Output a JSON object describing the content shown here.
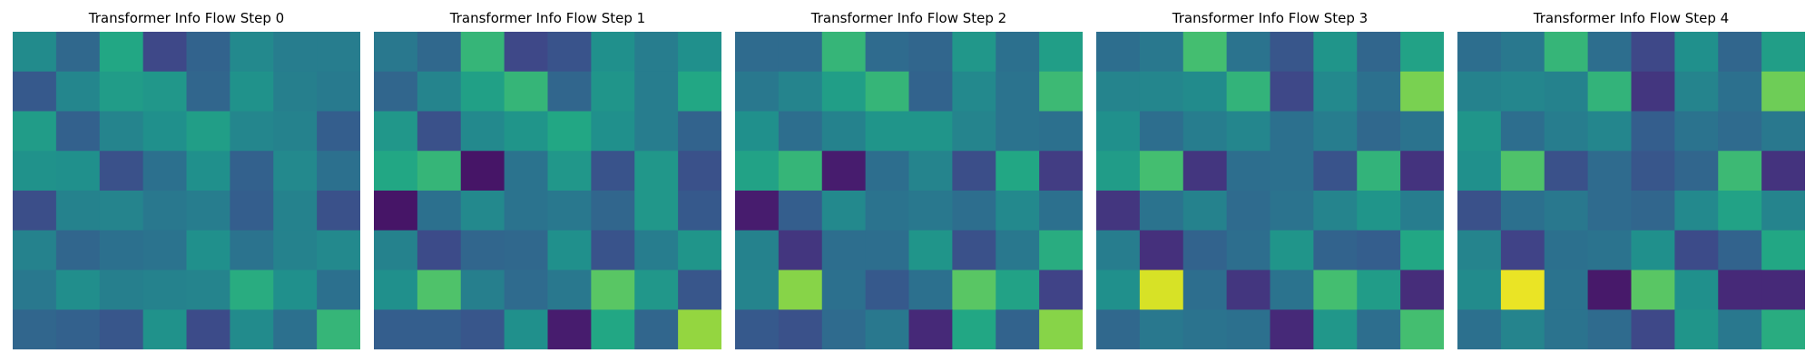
{
  "chart_data": [
    {
      "type": "heatmap",
      "title": "Transformer Info Flow Step 0",
      "rows": 8,
      "cols": 8,
      "colormap": "viridis",
      "vlim": [
        0,
        1
      ],
      "values": [
        [
          0.48,
          0.34,
          0.6,
          0.22,
          0.32,
          0.47,
          0.42,
          0.42
        ],
        [
          0.28,
          0.46,
          0.55,
          0.53,
          0.33,
          0.51,
          0.43,
          0.41
        ],
        [
          0.55,
          0.31,
          0.45,
          0.5,
          0.56,
          0.46,
          0.44,
          0.3
        ],
        [
          0.51,
          0.5,
          0.25,
          0.37,
          0.5,
          0.31,
          0.47,
          0.37
        ],
        [
          0.24,
          0.44,
          0.45,
          0.4,
          0.42,
          0.3,
          0.44,
          0.25
        ],
        [
          0.44,
          0.33,
          0.37,
          0.38,
          0.5,
          0.38,
          0.44,
          0.47
        ],
        [
          0.4,
          0.49,
          0.43,
          0.44,
          0.45,
          0.62,
          0.5,
          0.37
        ],
        [
          0.33,
          0.31,
          0.27,
          0.51,
          0.23,
          0.48,
          0.37,
          0.66
        ]
      ]
    },
    {
      "type": "heatmap",
      "title": "Transformer Info Flow Step 1",
      "rows": 8,
      "cols": 8,
      "colormap": "viridis",
      "vlim": [
        0,
        1
      ],
      "values": [
        [
          0.4,
          0.34,
          0.66,
          0.22,
          0.26,
          0.5,
          0.42,
          0.5
        ],
        [
          0.33,
          0.45,
          0.57,
          0.66,
          0.33,
          0.52,
          0.42,
          0.6
        ],
        [
          0.53,
          0.25,
          0.47,
          0.52,
          0.6,
          0.5,
          0.42,
          0.32
        ],
        [
          0.6,
          0.66,
          0.06,
          0.38,
          0.53,
          0.26,
          0.53,
          0.25
        ],
        [
          0.06,
          0.37,
          0.47,
          0.38,
          0.4,
          0.33,
          0.53,
          0.28
        ],
        [
          0.44,
          0.23,
          0.33,
          0.34,
          0.5,
          0.26,
          0.42,
          0.52
        ],
        [
          0.5,
          0.72,
          0.43,
          0.35,
          0.4,
          0.74,
          0.53,
          0.27
        ],
        [
          0.3,
          0.3,
          0.27,
          0.5,
          0.08,
          0.6,
          0.33,
          0.84
        ]
      ]
    },
    {
      "type": "heatmap",
      "title": "Transformer Info Flow Step 2",
      "rows": 8,
      "cols": 8,
      "colormap": "viridis",
      "vlim": [
        0,
        1
      ],
      "values": [
        [
          0.35,
          0.35,
          0.66,
          0.35,
          0.33,
          0.53,
          0.37,
          0.56
        ],
        [
          0.4,
          0.45,
          0.56,
          0.66,
          0.32,
          0.47,
          0.38,
          0.68
        ],
        [
          0.5,
          0.36,
          0.44,
          0.52,
          0.52,
          0.45,
          0.38,
          0.37
        ],
        [
          0.58,
          0.66,
          0.08,
          0.36,
          0.45,
          0.24,
          0.6,
          0.18
        ],
        [
          0.08,
          0.3,
          0.47,
          0.38,
          0.4,
          0.36,
          0.47,
          0.37
        ],
        [
          0.44,
          0.16,
          0.36,
          0.36,
          0.52,
          0.25,
          0.4,
          0.62
        ],
        [
          0.45,
          0.82,
          0.37,
          0.28,
          0.37,
          0.74,
          0.58,
          0.2
        ],
        [
          0.28,
          0.25,
          0.35,
          0.4,
          0.12,
          0.6,
          0.32,
          0.82
        ]
      ]
    },
    {
      "type": "heatmap",
      "title": "Transformer Info Flow Step 3",
      "rows": 8,
      "cols": 8,
      "colormap": "viridis",
      "vlim": [
        0,
        1
      ],
      "values": [
        [
          0.36,
          0.4,
          0.7,
          0.38,
          0.27,
          0.52,
          0.33,
          0.58
        ],
        [
          0.45,
          0.46,
          0.48,
          0.65,
          0.22,
          0.47,
          0.37,
          0.8
        ],
        [
          0.5,
          0.36,
          0.42,
          0.46,
          0.37,
          0.42,
          0.34,
          0.38
        ],
        [
          0.55,
          0.7,
          0.16,
          0.36,
          0.37,
          0.26,
          0.65,
          0.15
        ],
        [
          0.16,
          0.38,
          0.44,
          0.35,
          0.38,
          0.45,
          0.52,
          0.42
        ],
        [
          0.42,
          0.14,
          0.32,
          0.36,
          0.52,
          0.32,
          0.3,
          0.6
        ],
        [
          0.5,
          0.94,
          0.36,
          0.16,
          0.38,
          0.7,
          0.55,
          0.13
        ],
        [
          0.34,
          0.4,
          0.38,
          0.37,
          0.12,
          0.53,
          0.36,
          0.7
        ]
      ]
    },
    {
      "type": "heatmap",
      "title": "Transformer Info Flow Step 4",
      "rows": 8,
      "cols": 8,
      "colormap": "viridis",
      "vlim": [
        0,
        1
      ],
      "values": [
        [
          0.36,
          0.4,
          0.66,
          0.36,
          0.22,
          0.5,
          0.33,
          0.56
        ],
        [
          0.44,
          0.46,
          0.44,
          0.65,
          0.16,
          0.45,
          0.37,
          0.78
        ],
        [
          0.52,
          0.36,
          0.42,
          0.46,
          0.3,
          0.38,
          0.35,
          0.4
        ],
        [
          0.5,
          0.72,
          0.25,
          0.35,
          0.27,
          0.33,
          0.68,
          0.15
        ],
        [
          0.25,
          0.37,
          0.4,
          0.35,
          0.33,
          0.47,
          0.58,
          0.45
        ],
        [
          0.45,
          0.2,
          0.37,
          0.38,
          0.5,
          0.23,
          0.32,
          0.6
        ],
        [
          0.48,
          0.97,
          0.38,
          0.07,
          0.74,
          0.5,
          0.12,
          0.12
        ],
        [
          0.37,
          0.45,
          0.38,
          0.35,
          0.22,
          0.52,
          0.4,
          0.62
        ]
      ]
    }
  ]
}
